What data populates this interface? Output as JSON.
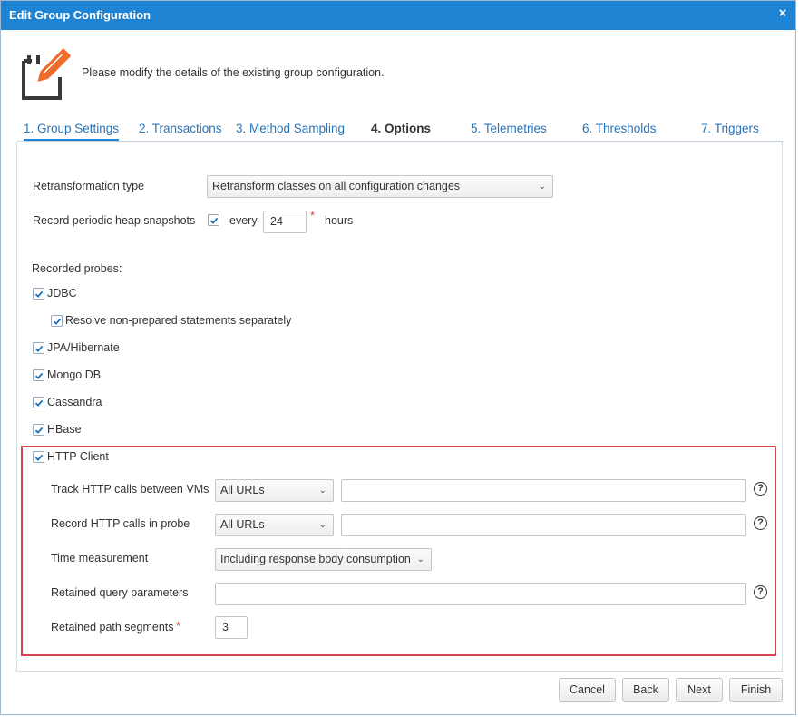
{
  "dialog": {
    "title": "Edit Group Configuration",
    "close_glyph": "×",
    "header_text": "Please modify the details of the existing group configuration.",
    "header_icon": "edit-document-icon"
  },
  "tabs": [
    {
      "label": "1. Group Settings",
      "active": false
    },
    {
      "label": "2. Transactions",
      "active": false
    },
    {
      "label": "3. Method Sampling",
      "active": false
    },
    {
      "label": "4. Options",
      "active": true
    },
    {
      "label": "5. Telemetries",
      "active": false
    },
    {
      "label": "6. Thresholds",
      "active": false
    },
    {
      "label": "7. Triggers",
      "active": false
    }
  ],
  "options": {
    "retransformation_label": "Retransformation type",
    "retransformation_value": "Retransform classes on all configuration changes",
    "heap_label": "Record periodic heap snapshots",
    "heap_checked": true,
    "heap_every": "every",
    "heap_value": "24",
    "heap_required": "*",
    "heap_unit": "hours"
  },
  "probes": {
    "heading": "Recorded probes:",
    "jdbc": "JDBC",
    "jdbc_sub": "Resolve non-prepared statements separately",
    "jpa": "JPA/Hibernate",
    "mongo": "Mongo DB",
    "cassandra": "Cassandra",
    "hbase": "HBase",
    "http_client": "HTTP Client"
  },
  "http": {
    "track_label": "Track HTTP calls between VMs",
    "track_value": "All URLs",
    "record_label": "Record HTTP calls in probe",
    "record_value": "All URLs",
    "time_label": "Time measurement",
    "time_value": "Including response body consumption",
    "query_label": "Retained query parameters",
    "path_label": "Retained path segments",
    "path_required": "*",
    "path_value": "3",
    "help_glyph": "?"
  },
  "buttons": {
    "cancel": "Cancel",
    "back": "Back",
    "next": "Next",
    "finish": "Finish"
  },
  "colors": {
    "titlebar": "#1f83d4",
    "tab_link": "#2a73b5",
    "highlight_border": "#d9434c",
    "checkbox_check": "#1f6fb8",
    "required": "#d9433c"
  }
}
